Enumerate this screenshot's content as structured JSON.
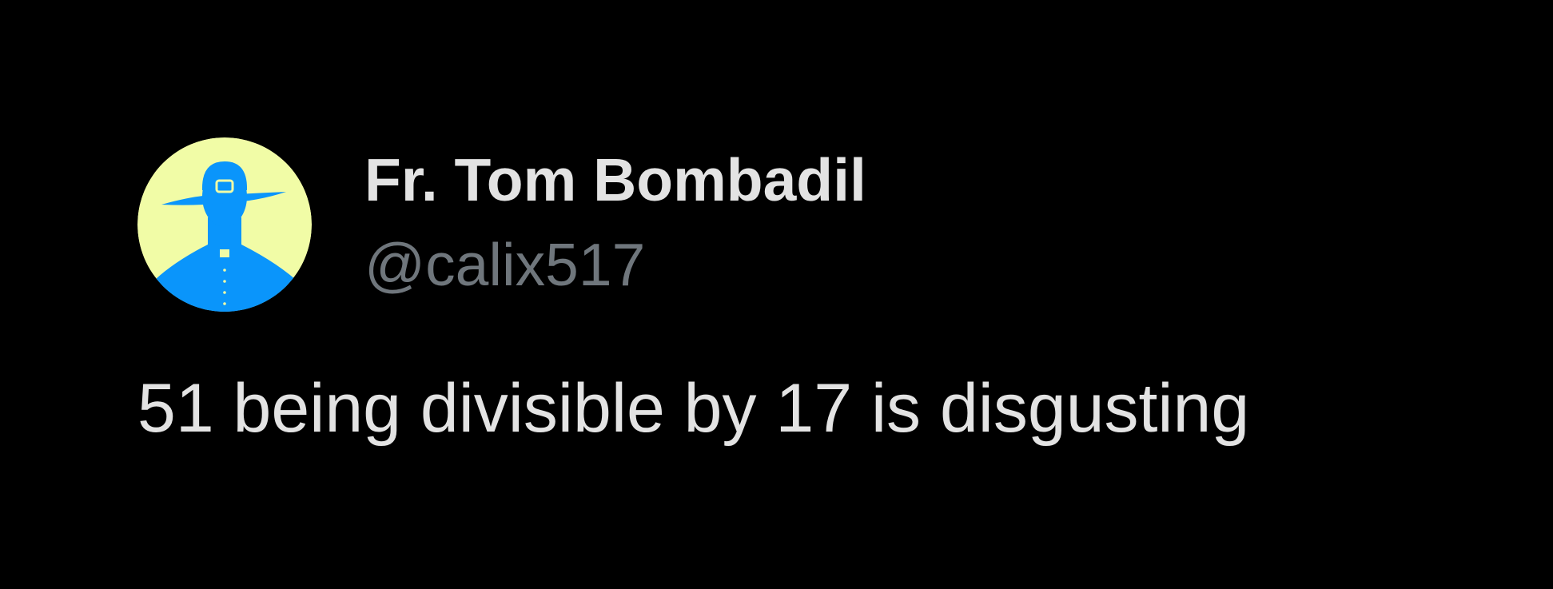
{
  "tweet": {
    "author": {
      "display_name": "Fr. Tom Bombadil",
      "handle": "@calix517",
      "avatar_icon": "priest-silhouette-icon"
    },
    "text": "51 being divisible by 17 is disgusting"
  },
  "colors": {
    "background": "#000000",
    "avatar_background": "#f1fca6",
    "avatar_figure": "#0a95fb",
    "name_text": "#e3e3e3",
    "handle_text": "#6f767c"
  }
}
